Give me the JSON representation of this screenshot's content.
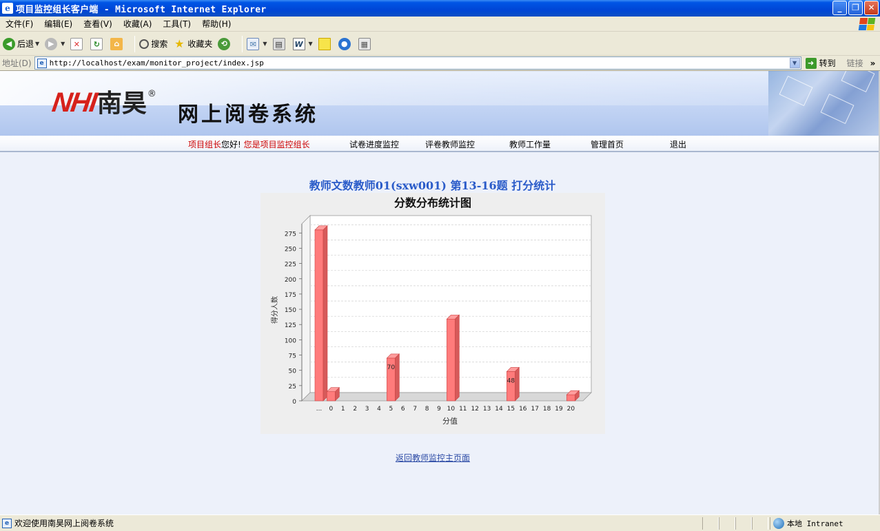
{
  "window": {
    "title": "项目监控组长客户端 - Microsoft Internet Explorer",
    "buttons": {
      "minimize": "_",
      "restore": "❐",
      "close": "✕"
    }
  },
  "menu": [
    "文件(F)",
    "编辑(E)",
    "查看(V)",
    "收藏(A)",
    "工具(T)",
    "帮助(H)"
  ],
  "toolbar": {
    "back": "后退",
    "search": "搜索",
    "favorites": "收藏夹"
  },
  "address": {
    "label": "地址(D)",
    "url": "http://localhost/exam/monitor_project/index.jsp",
    "go": "转到",
    "links": "链接"
  },
  "banner": {
    "logo_text": "NHI",
    "brand": "南昊",
    "reg": "®",
    "system": "网上阅卷系统"
  },
  "nav": {
    "greet_role": "项目组长",
    "greet_hello": "您好!",
    "greet_msg": "您是项目监控组长",
    "items": [
      "试卷进度监控",
      "评卷教师监控",
      "教师工作量",
      "管理首页",
      "退出"
    ]
  },
  "page": {
    "stat_title": "教师文数教师01(sxw001) 第13-16题 打分统计",
    "back_link": "返回教师监控主页面"
  },
  "chart_data": {
    "type": "bar",
    "title": "分数分布统计图",
    "xlabel": "分值",
    "ylabel": "得分人数",
    "categories": [
      "...",
      "0",
      "1",
      "2",
      "3",
      "4",
      "5",
      "6",
      "7",
      "8",
      "9",
      "10",
      "11",
      "12",
      "13",
      "14",
      "15",
      "16",
      "17",
      "18",
      "19",
      "20"
    ],
    "values": [
      280,
      15,
      0,
      0,
      0,
      0,
      70,
      0,
      0,
      0,
      0,
      134,
      0,
      0,
      0,
      0,
      48,
      0,
      0,
      0,
      0,
      10
    ],
    "data_labels": {
      "5": "70",
      "15": "48"
    },
    "yticks": [
      0,
      25,
      50,
      75,
      100,
      125,
      150,
      175,
      200,
      225,
      250,
      275
    ],
    "ylim": [
      0,
      290
    ],
    "grid": true,
    "bar_color": "#ff7b7b"
  },
  "status": {
    "message": "欢迎使用南昊网上阅卷系统",
    "zone": "本地 Intranet"
  }
}
